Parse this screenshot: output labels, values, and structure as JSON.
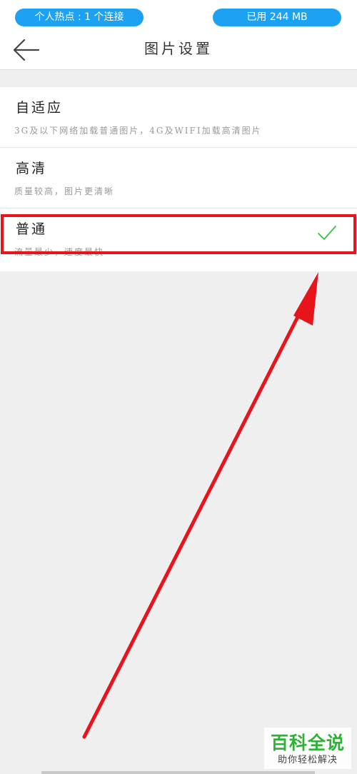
{
  "status_bar": {
    "hotspot_label": "个人热点 : 1 个连接",
    "usage_label": "已用 244 MB",
    "pill_color": "#1da1f2"
  },
  "nav": {
    "back_icon": "arrow-left-icon",
    "title": "图片设置"
  },
  "options": [
    {
      "title": "自适应",
      "description": "3G及以下网络加载普通图片，4G及WIFI加载高清图片",
      "selected": false
    },
    {
      "title": "高清",
      "description": "质量较高，图片更清晰",
      "selected": false
    },
    {
      "title": "普通",
      "description": "流量最少，速度最快",
      "selected": true
    }
  ],
  "check_icon": "checkmark-icon",
  "check_color": "#3cbf4a",
  "annotation_color": "#e8141c",
  "watermark": {
    "main": "百科全说",
    "sub": "助你轻松解决",
    "color": "#2eb135"
  }
}
